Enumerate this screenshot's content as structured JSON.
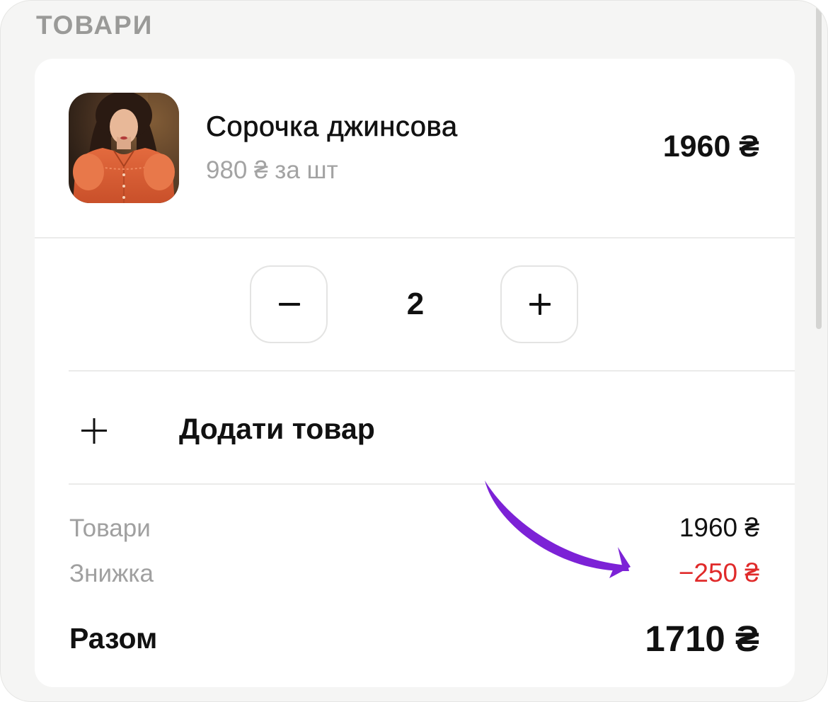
{
  "section": {
    "title": "ТОВАРИ"
  },
  "product": {
    "name": "Сорочка джинсова",
    "unit_price": "980 ₴ за шт",
    "line_total": "1960 ₴",
    "image": "product-photo"
  },
  "quantity": {
    "decrease_icon": "minus-icon",
    "value": "2",
    "increase_icon": "plus-icon"
  },
  "add_item": {
    "icon": "plus-icon",
    "label": "Додати товар"
  },
  "summary": {
    "items_label": "Товари",
    "items_value": "1960 ₴",
    "discount_label": "Знижка",
    "discount_value": "−250 ₴",
    "discount_color": "#e02a2a",
    "total_label": "Разом",
    "total_value": "1710 ₴"
  },
  "annotation": {
    "arrow_color": "#7c22d6",
    "icon": "curved-arrow-icon"
  }
}
